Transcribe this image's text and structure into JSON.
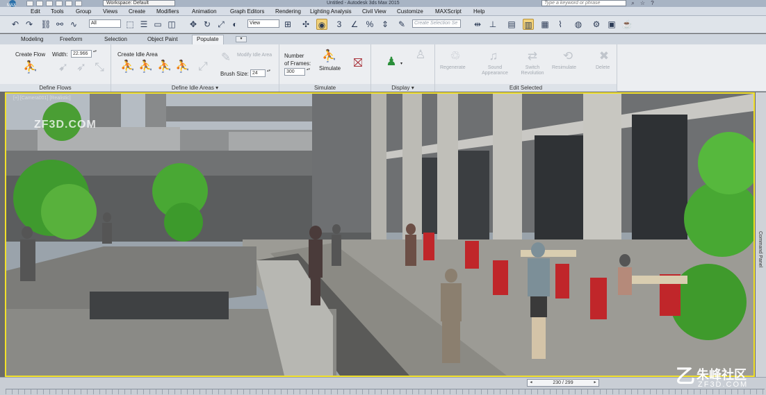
{
  "titlebar": {
    "app_icon": "3ds-max-logo-icon",
    "workspace": "Workspace: Default",
    "window_title": "Untitled - Autodesk 3ds Max 2015",
    "search_placeholder": "Type a keyword or phrase"
  },
  "menu": [
    "Edit",
    "Tools",
    "Group",
    "Views",
    "Create",
    "Modifiers",
    "Animation",
    "Graph Editors",
    "Rendering",
    "Lighting Analysis",
    "Civil View",
    "Customize",
    "MAXScript",
    "Help"
  ],
  "toolbar": {
    "selection_filter": "All",
    "reference_coord": "View",
    "named_selection_placeholder": "Create Selection Se",
    "snap_label": "3"
  },
  "ribbon_tabs": [
    "Modeling",
    "Freeform",
    "Selection",
    "Object Paint",
    "Populate"
  ],
  "ribbon_active_tab": "Populate",
  "ribbon": {
    "define_flows": {
      "create_flow_label": "Create Flow",
      "width_label": "Width:",
      "width_value": "22.966",
      "title": "Define Flows"
    },
    "define_idle_areas": {
      "create_idle_area_label": "Create Idle Area",
      "modify_idle_area_label": "Modify Idle Area",
      "brush_size_label": "Brush Size:",
      "brush_size_value": "24",
      "title": "Define Idle Areas"
    },
    "simulate": {
      "number_of_frames_label_1": "Number",
      "number_of_frames_label_2": "of Frames:",
      "frames_value": "300",
      "simulate_label": "Simulate",
      "title": "Simulate"
    },
    "display": {
      "title": "Display"
    },
    "edit_selected": {
      "buttons": [
        "Regenerate",
        "Sound Appearance",
        "Switch Revolution",
        "Resimulate",
        "Delete"
      ],
      "title": "Edit Selected"
    }
  },
  "viewport": {
    "label": "[+] [Camera001] [Realistic]"
  },
  "command_panel": {
    "label": "Command Panel"
  },
  "timeline": {
    "frame": "230 / 299"
  },
  "watermark": {
    "left": "ZF3D.COM",
    "right_cn": "朱峰社区",
    "right_en": "ZF3D.COM"
  }
}
